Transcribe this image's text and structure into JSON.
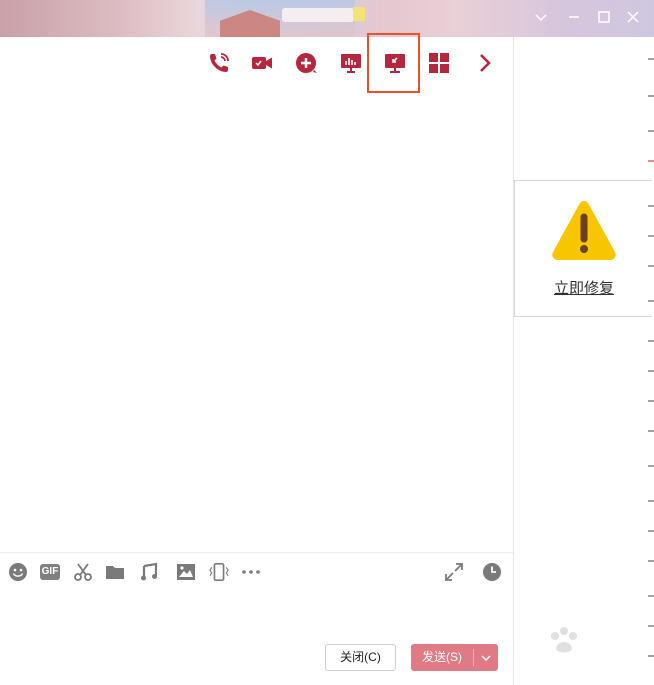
{
  "toolbar": {
    "items": [
      {
        "name": "voice-call",
        "icon": "phone-icon"
      },
      {
        "name": "video-call",
        "icon": "video-camera-icon"
      },
      {
        "name": "add-member",
        "icon": "plus-circle-icon"
      },
      {
        "name": "presentation",
        "icon": "presentation-board-icon"
      },
      {
        "name": "remote-desktop",
        "icon": "remote-desktop-icon"
      },
      {
        "name": "apps",
        "icon": "grid-icon"
      },
      {
        "name": "more",
        "icon": "chevron-right-icon"
      }
    ]
  },
  "input_toolbar": {
    "emoji": "emoji-icon",
    "gif_label": "GIF",
    "screenshot": "scissors-icon",
    "file": "folder-icon",
    "music": "music-note-icon",
    "image": "image-icon",
    "shake": "phone-shake-icon",
    "more": "more-dots-icon",
    "expand": "expand-icon",
    "history": "clock-icon"
  },
  "buttons": {
    "close_label": "关闭(C)",
    "send_label": "发送(S)"
  },
  "warning": {
    "link_text": "立即修复",
    "icon": "warning-triangle-icon"
  },
  "colors": {
    "accent": "#b5263f",
    "send": "#e07a84",
    "highlight": "#e8532a",
    "warning": "#f7c600"
  }
}
